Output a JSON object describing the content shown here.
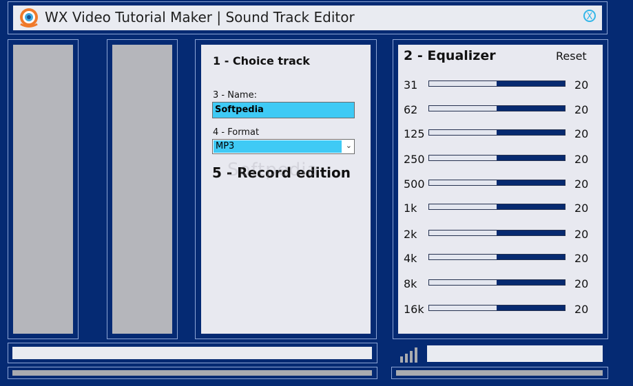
{
  "window": {
    "title": "WX Video Tutorial Maker | Sound Track Editor",
    "close_glyph": "X",
    "app_icon": "camera-lens-logo-icon"
  },
  "track_panel": {
    "heading": "1 - Choice track",
    "name_label": "3 - Name:",
    "name_value": "Softpedia",
    "format_label": "4 - Format",
    "format_value": "MP3",
    "record_heading": "5 - Record edition",
    "watermark": "Softpedia"
  },
  "equalizer": {
    "heading": "2 - Equalizer",
    "reset_label": "Reset",
    "bands": [
      {
        "freq": "31",
        "value": "20",
        "level": 0.5
      },
      {
        "freq": "62",
        "value": "20",
        "level": 0.5
      },
      {
        "freq": "125",
        "value": "20",
        "level": 0.5
      },
      {
        "freq": "250",
        "value": "20",
        "level": 0.5
      },
      {
        "freq": "500",
        "value": "20",
        "level": 0.5
      },
      {
        "freq": "1k",
        "value": "20",
        "level": 0.5
      },
      {
        "freq": "2k",
        "value": "20",
        "level": 0.5
      },
      {
        "freq": "4k",
        "value": "20",
        "level": 0.5
      },
      {
        "freq": "8k",
        "value": "20",
        "level": 0.5
      },
      {
        "freq": "16k",
        "value": "20",
        "level": 0.5
      }
    ]
  },
  "colors": {
    "background": "#052a73",
    "panel": "#e8e9f0",
    "accent": "#3fcaf5",
    "eq_fill": "#072a70"
  }
}
